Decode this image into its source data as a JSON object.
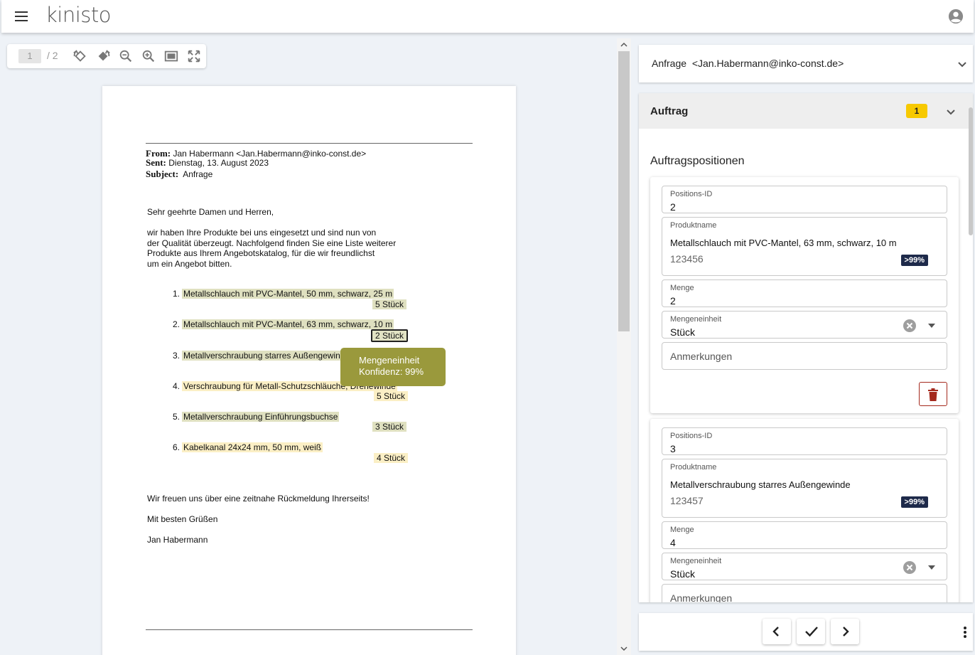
{
  "app": {
    "logo_text": "kinisto",
    "colors": {
      "accent_yellow": "#f7c900",
      "tooltip": "#9a993c",
      "badge_navy": "#1e2a4a",
      "delete_red": "#a4291d"
    }
  },
  "viewer": {
    "page_current": "1",
    "page_total": "/ 2",
    "toolbar_icons": [
      "rotate-left-icon",
      "rotate-right-icon",
      "zoom-out-icon",
      "zoom-in-icon",
      "fit-page-icon",
      "fullscreen-icon"
    ],
    "email": {
      "from_label": "From:",
      "from_value": "Jan Habermann <Jan.Habermann@inko-const.de>",
      "sent_label": "Sent:",
      "sent_value": "Dienstag, 13. August 2023",
      "subject_label": "Subject:",
      "subject_value": "Anfrage",
      "greeting": "Sehr geehrte Damen und Herren,",
      "intro": [
        "wir haben Ihre Produkte bei uns eingesetzt und sind nun von",
        "der Qualität überzeugt. Nachfolgend finden Sie eine Liste weiterer",
        "Produkte aus Ihrem Angebotskatalog, für die wir freundlichst",
        "um ein Angebot bitten."
      ],
      "items": [
        {
          "num": "1.",
          "name": "Metallschlauch mit PVC-Mantel, 50 mm, schwarz, 25 m",
          "qty": "5 Stück"
        },
        {
          "num": "2.",
          "name": "Metallschlauch mit PVC-Mantel, 63 mm, schwarz, 10 m",
          "qty": "2 Stück"
        },
        {
          "num": "3.",
          "name": "Metallverschraubung starres Außengewinde",
          "qty": ""
        },
        {
          "num": "4.",
          "name": "Verschraubung für Metall-Schutzschläuche, Drehewinde",
          "qty": "5 Stück"
        },
        {
          "num": "5.",
          "name": "Metallverschraubung Einführungsbuchse",
          "qty": "3 Stück"
        },
        {
          "num": "6.",
          "name": "Kabelkanal 24x24 mm, 50 mm, weiß",
          "qty": "4 Stück"
        }
      ],
      "closing": "Wir freuen uns über eine zeitnahe Rückmeldung Ihrerseits!",
      "regards": "Mit besten Grüßen",
      "signature": "Jan Habermann"
    },
    "tooltip": {
      "line1": "Mengeneinheit",
      "line2": "Konfidenz: 99%"
    }
  },
  "panel": {
    "anfrage_label": "Anfrage  <Jan.Habermann@inko-const.de>",
    "auftrag_title": "Auftrag",
    "auftrag_badge": "1",
    "section_title": "Auftragspositionen",
    "labels": {
      "positions_id": "Positions-ID",
      "produktname": "Produktname",
      "menge": "Menge",
      "mengeneinheit": "Mengeneinheit",
      "anmerkungen": "Anmerkungen"
    },
    "positions": [
      {
        "id": "2",
        "product": "Metallschlauch mit PVC-Mantel, 63 mm, schwarz, 10 m",
        "article": "123456",
        "confidence": ">99%",
        "qty": "2",
        "unit": "Stück"
      },
      {
        "id": "3",
        "product": "Metallverschraubung starres Außengewinde",
        "article": "123457",
        "confidence": ">99%",
        "qty": "4",
        "unit": "Stück"
      }
    ]
  }
}
